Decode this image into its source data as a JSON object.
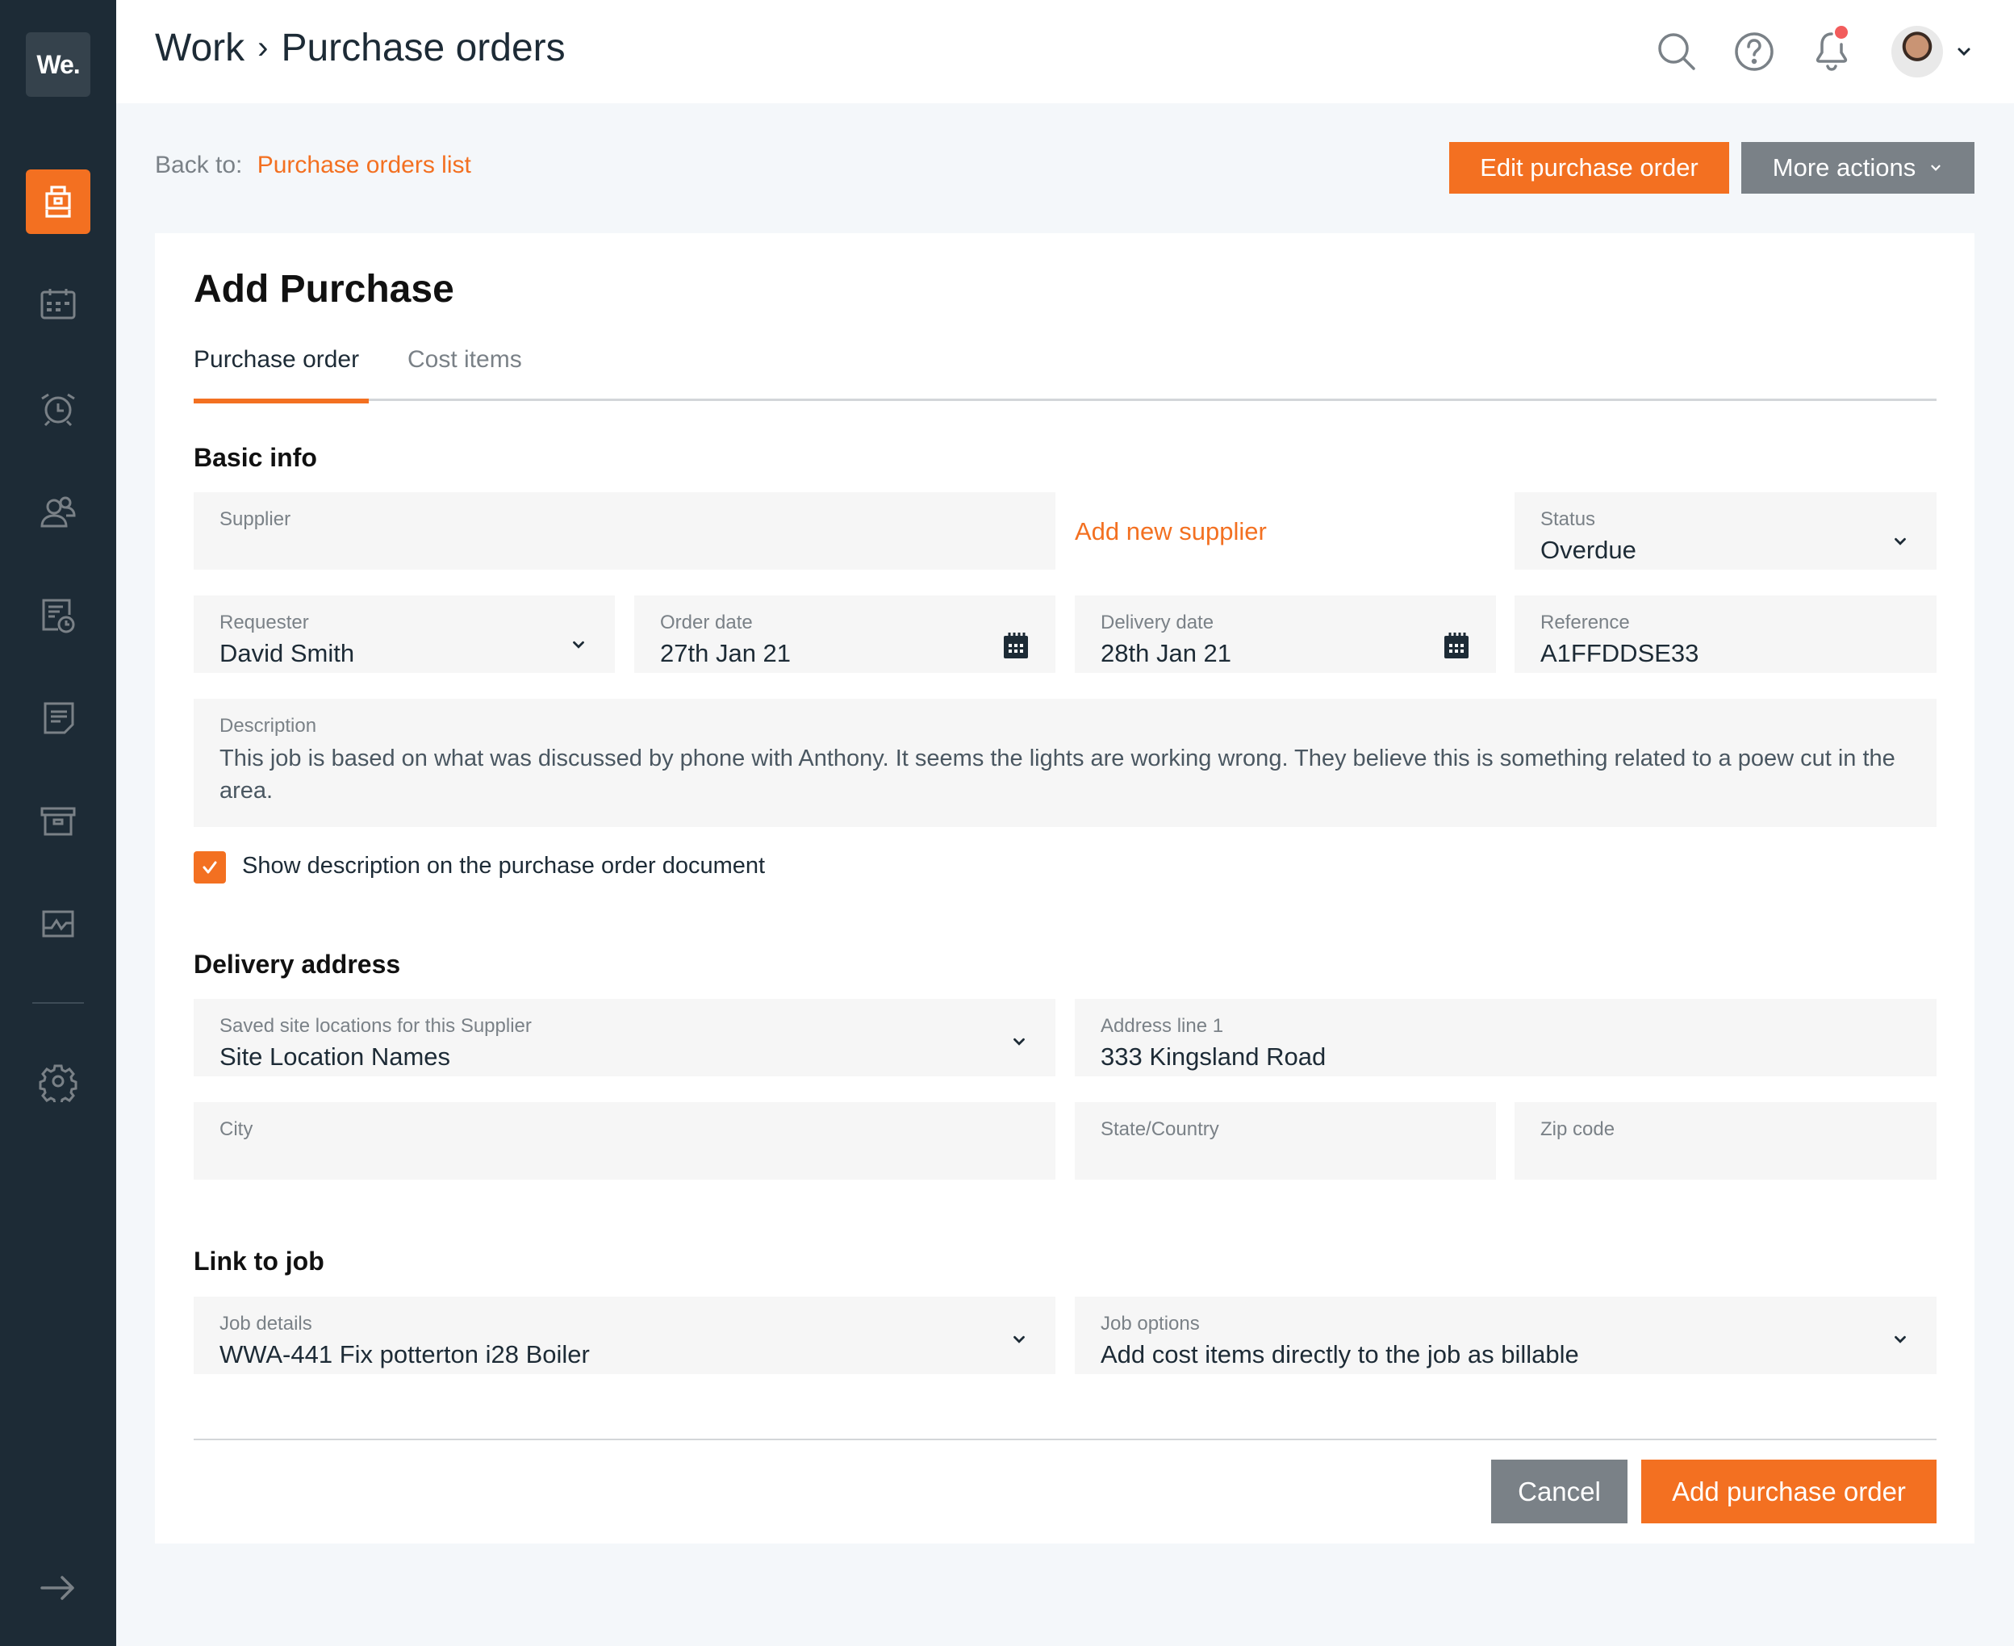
{
  "app": {
    "logo_text": "We.",
    "colors": {
      "accent": "#f37021",
      "sidebar": "#1d2b36",
      "secondary_button": "#7a8187",
      "notification_dot": "#f25c5c"
    }
  },
  "sidebar": {
    "items": [
      {
        "name": "work",
        "icon": "briefcase-icon",
        "active": true
      },
      {
        "name": "schedule",
        "icon": "calendar-icon",
        "active": false
      },
      {
        "name": "timesheets",
        "icon": "alarm-clock-icon",
        "active": false
      },
      {
        "name": "customers",
        "icon": "users-icon",
        "active": false
      },
      {
        "name": "quotes",
        "icon": "document-clock-icon",
        "active": false
      },
      {
        "name": "notes",
        "icon": "note-icon",
        "active": false
      },
      {
        "name": "archive",
        "icon": "archive-box-icon",
        "active": false
      },
      {
        "name": "reports",
        "icon": "activity-chart-icon",
        "active": false
      }
    ],
    "settings_icon": "gear-icon",
    "expand_icon": "arrow-right-icon"
  },
  "header": {
    "breadcrumb": {
      "parent": "Work",
      "separator": "›",
      "current": "Purchase orders"
    },
    "icons": [
      "search-icon",
      "help-icon",
      "bell-icon",
      "avatar",
      "chevron-down-icon"
    ],
    "has_notification": true
  },
  "toolbar": {
    "back_label": "Back to:",
    "back_link": "Purchase orders list",
    "edit_button": "Edit purchase order",
    "more_actions_button": "More actions"
  },
  "form": {
    "title": "Add Purchase",
    "tabs": [
      {
        "label": "Purchase order",
        "active": true
      },
      {
        "label": "Cost items",
        "active": false
      }
    ],
    "sections": {
      "basic_info": "Basic info",
      "delivery_address": "Delivery address",
      "link_to_job": "Link to job"
    },
    "fields": {
      "supplier": {
        "label": "Supplier",
        "value": ""
      },
      "add_new_supplier": "Add new supplier",
      "status": {
        "label": "Status",
        "value": "Overdue"
      },
      "requester": {
        "label": "Requester",
        "value": "David Smith"
      },
      "order_date": {
        "label": "Order date",
        "value": "27th Jan 21"
      },
      "delivery_date": {
        "label": "Delivery date",
        "value": "28th Jan 21"
      },
      "reference": {
        "label": "Reference",
        "value": "A1FFDDSE33"
      },
      "description": {
        "label": "Description",
        "value": "This job is based on what was discussed by phone with Anthony. It seems the lights are working wrong. They believe this is something related to a poew cut in the area."
      },
      "show_description": {
        "label": "Show description on the purchase order document",
        "checked": true
      },
      "saved_locations": {
        "label": "Saved site locations for this Supplier",
        "value": "Site Location Names"
      },
      "address_line_1": {
        "label": "Address line 1",
        "value": "333 Kingsland Road"
      },
      "city": {
        "label": "City",
        "value": ""
      },
      "state_country": {
        "label": "State/Country",
        "value": ""
      },
      "zip_code": {
        "label": "Zip code",
        "value": ""
      },
      "job_details": {
        "label": "Job details",
        "value": "WWA-441 Fix potterton i28 Boiler"
      },
      "job_options": {
        "label": "Job options",
        "value": "Add cost items directly to the job as billable"
      }
    },
    "actions": {
      "cancel": "Cancel",
      "submit": "Add purchase order"
    }
  }
}
